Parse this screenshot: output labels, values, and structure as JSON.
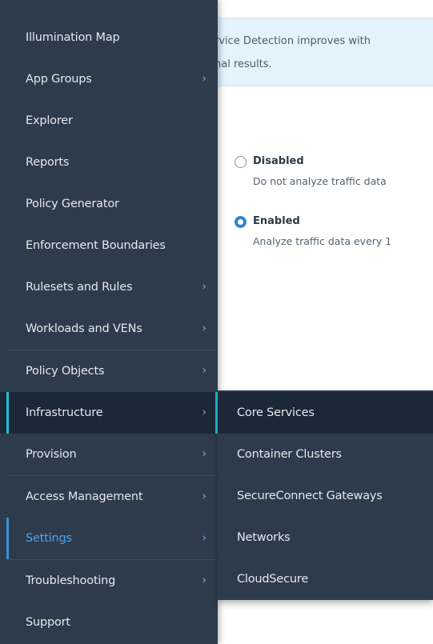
{
  "banner": {
    "line1": "rvice Detection improves with",
    "line2": "nal results."
  },
  "options": [
    {
      "title": "Disabled",
      "desc": "Do not analyze traffic data",
      "selected": false
    },
    {
      "title": "Enabled",
      "desc": "Analyze traffic data every 1",
      "selected": true
    }
  ],
  "menu": {
    "items": [
      {
        "label": "Illumination Map",
        "chevron": ""
      },
      {
        "label": "App Groups",
        "chevron": "›"
      },
      {
        "label": "Explorer",
        "chevron": ""
      },
      {
        "label": "Reports",
        "chevron": ""
      },
      {
        "label": "Policy Generator",
        "chevron": ""
      },
      {
        "label": "Enforcement Boundaries",
        "chevron": ""
      },
      {
        "label": "Rulesets and Rules",
        "chevron": "›"
      },
      {
        "label": "Workloads and VENs",
        "chevron": "›"
      },
      {
        "label": "Policy Objects",
        "chevron": "›"
      },
      {
        "label": "Infrastructure",
        "chevron": "›"
      },
      {
        "label": "Provision",
        "chevron": "›"
      },
      {
        "label": "Access Management",
        "chevron": "›"
      },
      {
        "label": "Settings",
        "chevron": "›"
      },
      {
        "label": "Troubleshooting",
        "chevron": "›"
      },
      {
        "label": "Support",
        "chevron": ""
      }
    ],
    "expanded_item": "Infrastructure",
    "current_item": "Settings"
  },
  "submenu": {
    "items": [
      {
        "label": "Core Services"
      },
      {
        "label": "Container Clusters"
      },
      {
        "label": "SecureConnect Gateways"
      },
      {
        "label": "Networks"
      },
      {
        "label": "CloudSecure"
      }
    ],
    "active_item": "Core Services"
  },
  "colors": {
    "menu_bg": "#2e3b4d",
    "menu_active_bg": "#1c2738",
    "active_accent": "#1ec2d2",
    "current_accent": "#4aa3ee",
    "banner_bg": "#e4f2fb",
    "radio_selected": "#2f86cf"
  }
}
